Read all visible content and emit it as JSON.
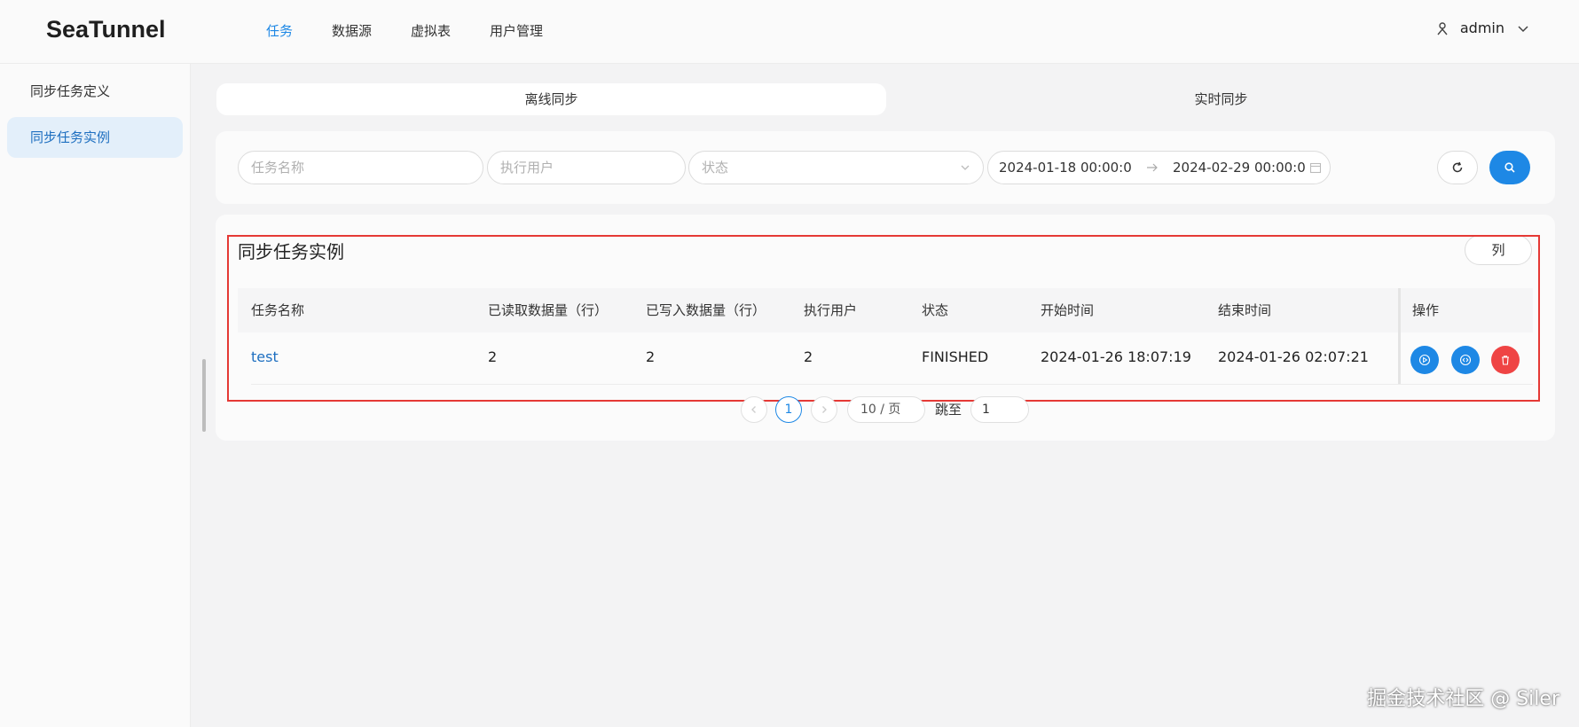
{
  "app": {
    "logo": "SeaTunnel"
  },
  "topnav": {
    "items": [
      "任务",
      "数据源",
      "虚拟表",
      "用户管理"
    ],
    "active_index": 0
  },
  "user": {
    "name": "admin"
  },
  "sidebar": {
    "items": [
      "同步任务定义",
      "同步任务实例"
    ],
    "active_index": 1
  },
  "segment": {
    "tabs": [
      "离线同步",
      "实时同步"
    ],
    "active_index": 0
  },
  "filters": {
    "task_name_placeholder": "任务名称",
    "exec_user_placeholder": "执行用户",
    "status_placeholder": "状态",
    "date_start": "2024-01-18 00:00:0(",
    "date_end": "2024-02-29 00:00:0("
  },
  "table": {
    "title": "同步任务实例",
    "columns_button": "列",
    "headers": [
      "任务名称",
      "已读取数据量（行）",
      "已写入数据量（行）",
      "执行用户",
      "状态",
      "开始时间",
      "结束时间",
      "操作"
    ],
    "rows": [
      {
        "name": "test",
        "read_rows": "2",
        "written_rows": "2",
        "exec_user": "2",
        "status": "FINISHED",
        "start_time": "2024-01-26 18:07:19",
        "end_time": "2024-01-26 02:07:21"
      }
    ]
  },
  "pagination": {
    "current_page": "1",
    "page_size": "10 / 页",
    "jump_label": "跳至",
    "jump_value": "1"
  },
  "watermark": "掘金技术社区 @ Siler",
  "colors": {
    "accent": "#1e88e5",
    "danger": "#ef4444",
    "highlight": "#e53935"
  }
}
